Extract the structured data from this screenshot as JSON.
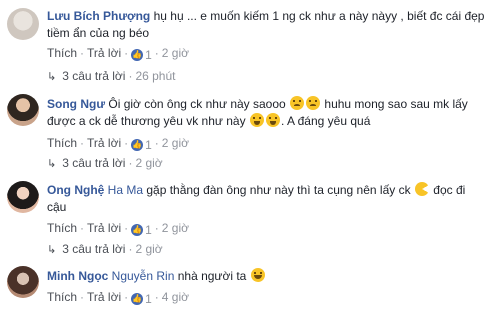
{
  "comments": [
    {
      "author": "Lưu Bích Phượng",
      "text": "hụ hụ ... e muốn kiếm 1 ng ck như a này nàyy , biết đc cái đẹp tiềm ẩn của ng béo",
      "actions": {
        "like": "Thích",
        "reply": "Trả lời",
        "like_count": "1",
        "time": "2 giờ"
      },
      "replies": {
        "label": "3 câu trả lời",
        "time": "26 phút"
      }
    },
    {
      "author": "Song Ngư",
      "text_part1": "Ôi giờ còn ông ck như này saooo",
      "text_part2": "huhu mong sao sau mk lấy được a ck dễ thương yêu vk như này",
      "text_part3": ". A đáng yêu quá",
      "actions": {
        "like": "Thích",
        "reply": "Trả lời",
        "like_count": "1",
        "time": "2 giờ"
      },
      "replies": {
        "label": "3 câu trả lời",
        "time": "2 giờ"
      }
    },
    {
      "author": "Ong Nghệ",
      "mention": "Ha Ma",
      "text": "gặp thằng đàn ông như này thì ta cụng nên lấy ck",
      "text_end": "đọc đi cậu",
      "actions": {
        "like": "Thích",
        "reply": "Trả lời",
        "like_count": "1",
        "time": "2 giờ"
      },
      "replies": {
        "label": "3 câu trả lời",
        "time": "2 giờ"
      }
    },
    {
      "author": "Minh Ngọc",
      "mention": "Nguyễn Rin",
      "text": "nhà người ta",
      "actions": {
        "like": "Thích",
        "reply": "Trả lời",
        "like_count": "1",
        "time": "4 giờ"
      }
    }
  ],
  "icons": {
    "like_badge": "like-thumb-icon",
    "reply_arrow": "reply-arrow-icon",
    "emoji_squint": "squinting-face-icon",
    "emoji_tongue": "tongue-face-icon",
    "emoji_laugh": "laughing-face-icon",
    "emoji_pacman": "pacman-icon"
  },
  "colors": {
    "link": "#365899",
    "meta": "#90949c",
    "like_badge": "#4267b2",
    "emoji": "#f8c427"
  }
}
